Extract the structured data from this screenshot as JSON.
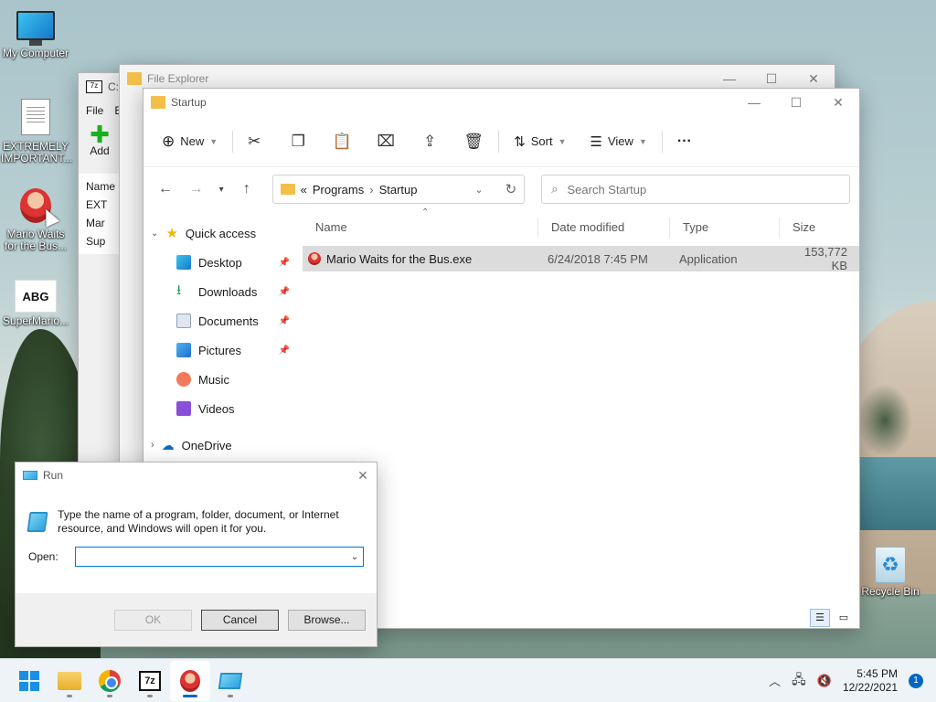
{
  "desktop": {
    "icons": [
      {
        "label": "My Computer"
      },
      {
        "label": "EXTREMELY IMPORTANT..."
      },
      {
        "label": "Mario Waits for the Bus..."
      },
      {
        "label": "SuperMario..."
      },
      {
        "label": "Recycle Bin"
      }
    ],
    "abg_text": "ABG"
  },
  "sevenzip": {
    "title": "C:\\",
    "menu": [
      "File",
      "E"
    ],
    "add_label": "Add",
    "name_header": "Name",
    "items": [
      "EXT",
      "Mar",
      "Sup"
    ]
  },
  "explorer_back": {
    "title": "File Explorer"
  },
  "explorer": {
    "title": "Startup",
    "toolbar": {
      "new": "New",
      "sort": "Sort",
      "view": "View",
      "more": "···"
    },
    "address": {
      "prefix": "«",
      "crumbs": [
        "Programs",
        "Startup"
      ]
    },
    "search_placeholder": "Search Startup",
    "nav": {
      "quick_access": "Quick access",
      "items": [
        "Desktop",
        "Downloads",
        "Documents",
        "Pictures",
        "Music",
        "Videos"
      ],
      "onedrive": "OneDrive"
    },
    "columns": [
      "Name",
      "Date modified",
      "Type",
      "Size"
    ],
    "files": [
      {
        "name": "Mario Waits for the Bus.exe",
        "modified": "6/24/2018 7:45 PM",
        "type": "Application",
        "size": "153,772 KB"
      }
    ]
  },
  "run": {
    "title": "Run",
    "description": "Type the name of a program, folder, document, or Internet resource, and Windows will open it for you.",
    "open_label": "Open:",
    "value": "",
    "ok": "OK",
    "cancel": "Cancel",
    "browse": "Browse..."
  },
  "taskbar": {
    "time": "5:45 PM",
    "date": "12/22/2021",
    "notifications": "1"
  }
}
